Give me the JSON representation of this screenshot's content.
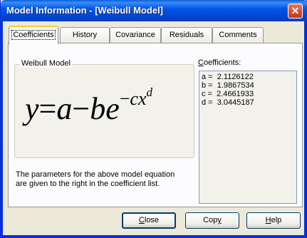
{
  "window": {
    "title": "Model Information - [Weibull Model]",
    "close_glyph": "✕"
  },
  "tabs": [
    {
      "label": "Coefficients",
      "active": true
    },
    {
      "label": "History"
    },
    {
      "label": "Covariance"
    },
    {
      "label": "Residuals"
    },
    {
      "label": "Comments"
    }
  ],
  "model_group": {
    "legend": "Weibull Model",
    "equation": {
      "y": "y",
      "eq": "=",
      "a": "a",
      "minus": "−",
      "b": "b",
      "e": "e",
      "neg": "−",
      "c": "c",
      "x": "x",
      "d": "d"
    }
  },
  "description": "The parameters for the above model equation are given to the right in the coefficient list.",
  "coefficients": {
    "label_first": "C",
    "label_rest": "oefficients:",
    "rows": [
      {
        "name": "a",
        "sep": " =  ",
        "value": "2.1126122"
      },
      {
        "name": "b",
        "sep": " =  ",
        "value": "1.9867534"
      },
      {
        "name": "c",
        "sep": " =  ",
        "value": "2.4661933"
      },
      {
        "name": "d",
        "sep": " =  ",
        "value": "3.0445187"
      }
    ]
  },
  "buttons": {
    "close_first": "C",
    "close_rest": "lose",
    "copy_pre": "Cop",
    "copy_u": "y",
    "help_first": "H",
    "help_rest": "elp"
  }
}
